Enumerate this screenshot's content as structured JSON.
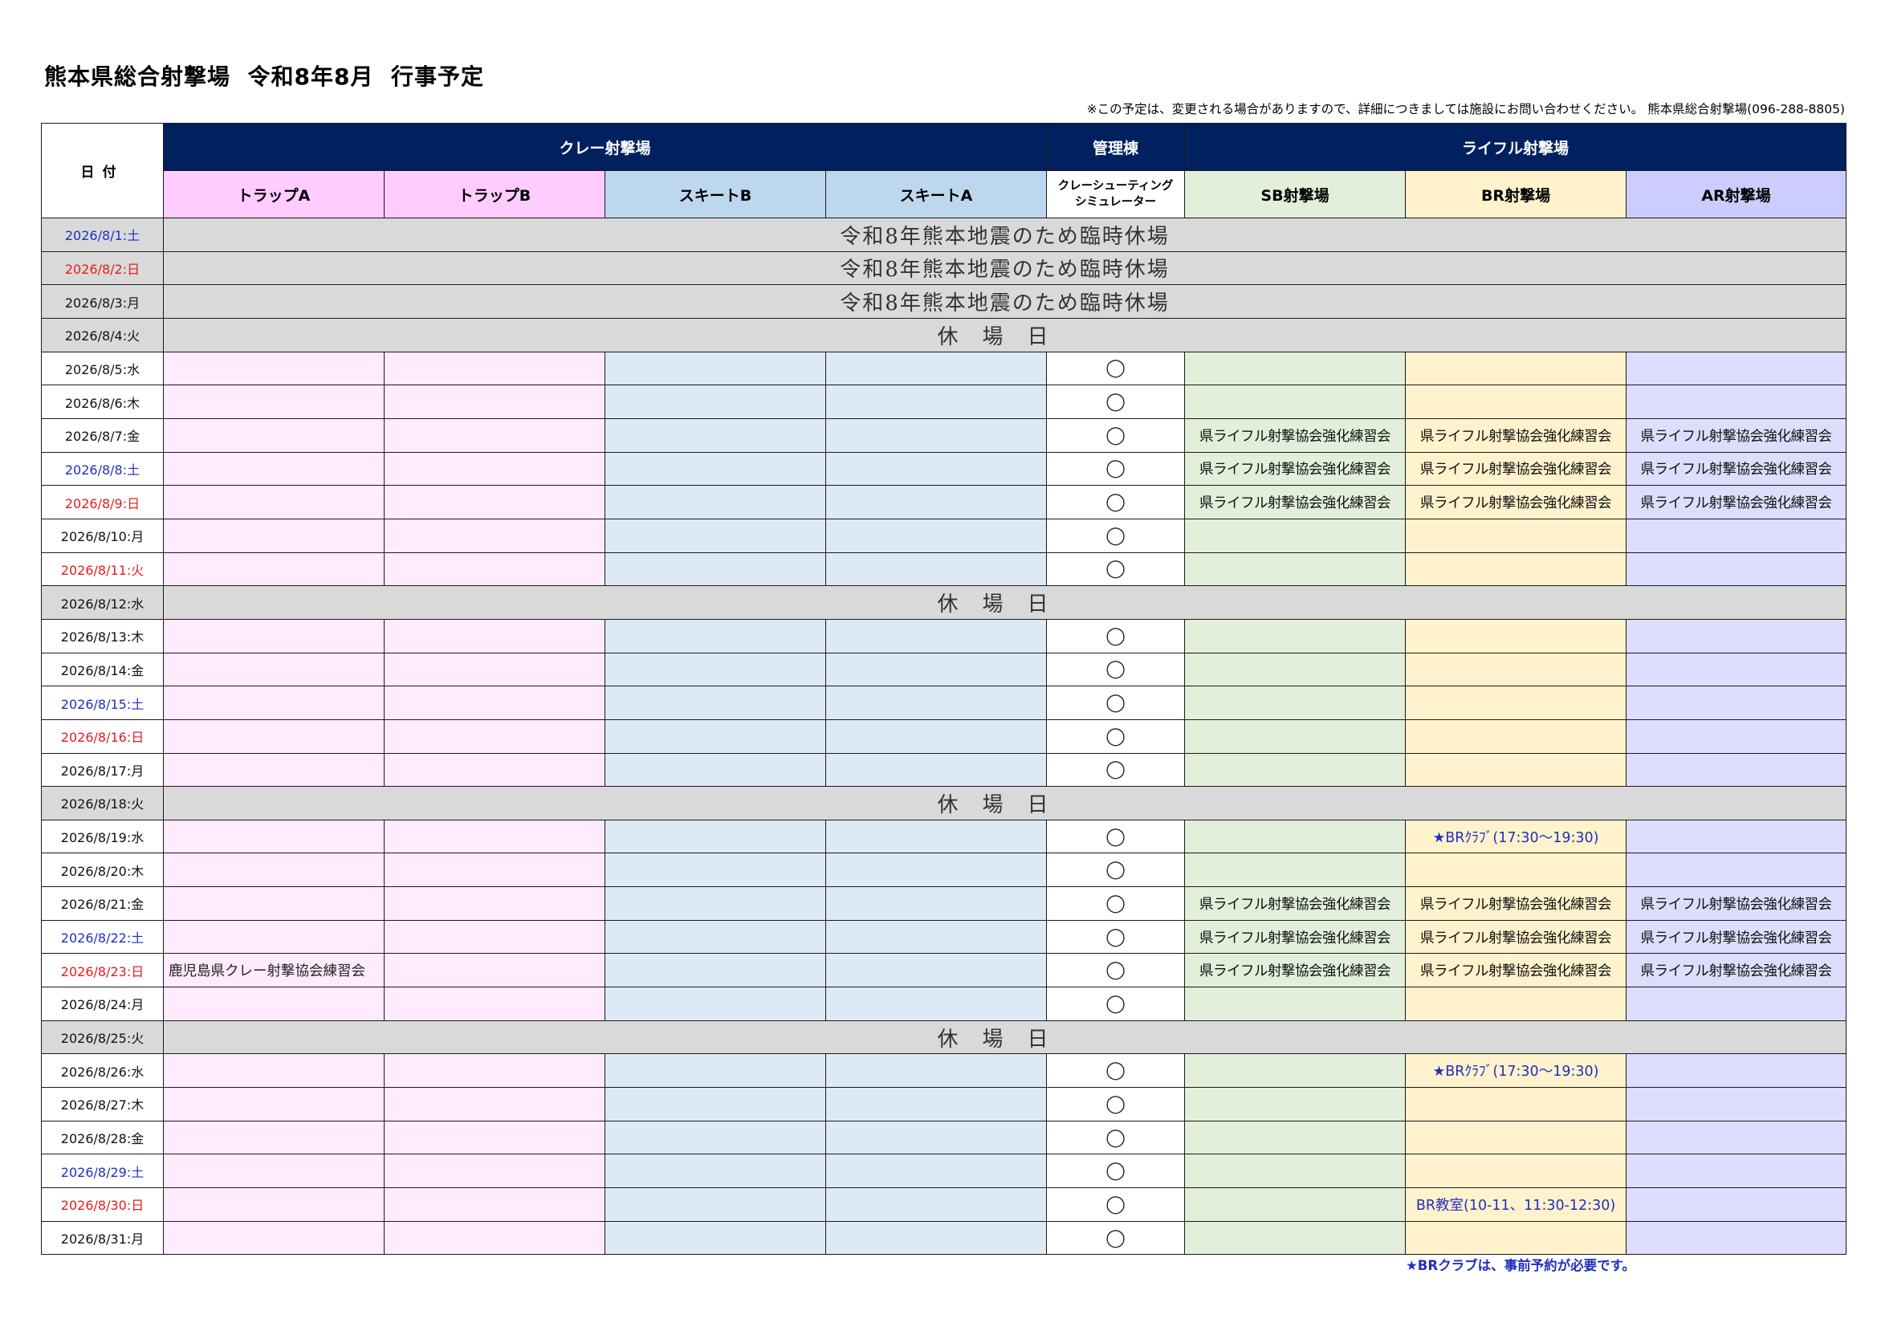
{
  "title": "熊本県総合射撃場  令和8年8月  行事予定",
  "notice": "※この予定は、変更される場合がありますので、詳細につきましては施設にお問い合わせください。 熊本県総合射撃場(096-288-8805)",
  "header": {
    "date_label": "日付",
    "group_clay": "クレー射撃場",
    "group_admin": "管理棟",
    "group_rifle": "ライフル射撃場",
    "trap_a": "トラップA",
    "trap_b": "トラップB",
    "skeet_b": "スキートB",
    "skeet_a": "スキートA",
    "simulator_line1": "クレーシューティング",
    "simulator_line2": "シミュレーター",
    "sb": "SB射撃場",
    "br": "BR射撃場",
    "ar": "AR射撃場"
  },
  "text": {
    "closed_earthquake": "令和8年熊本地震のため臨時休場",
    "closed_day": "休場日",
    "open_mark": "◯",
    "rifle_practice": "県ライフル射撃協会強化練習会",
    "br_club": "★BRｸﾗﾌﾞ(17:30～19:30)",
    "br_class": "BR教室(10-11、11:30-12:30)",
    "kagoshima_practice": "鹿児島県クレー射撃協会練習会"
  },
  "colors": {
    "header_navy": "#002060",
    "trap": "#ffccff",
    "skeet": "#bdd7ee",
    "sb": "#e2efda",
    "br": "#fff2cc",
    "ar": "#ccccff",
    "closed": "#d9d9d9",
    "saturday": "#1f2fbf",
    "holiday": "#e51c1c"
  },
  "rows": [
    {
      "date": "2026/8/1:土",
      "color": "blue",
      "status": "closed_earthquake"
    },
    {
      "date": "2026/8/2:日",
      "color": "red",
      "status": "closed_earthquake"
    },
    {
      "date": "2026/8/3:月",
      "color": "black",
      "status": "closed_earthquake"
    },
    {
      "date": "2026/8/4:火",
      "color": "black",
      "status": "closed_day"
    },
    {
      "date": "2026/8/5:水",
      "color": "black",
      "status": "open"
    },
    {
      "date": "2026/8/6:木",
      "color": "black",
      "status": "open"
    },
    {
      "date": "2026/8/7:金",
      "color": "black",
      "status": "open",
      "sb": "rifle_practice",
      "br": "rifle_practice",
      "ar": "rifle_practice"
    },
    {
      "date": "2026/8/8:土",
      "color": "blue",
      "status": "open",
      "sb": "rifle_practice",
      "br": "rifle_practice",
      "ar": "rifle_practice"
    },
    {
      "date": "2026/8/9:日",
      "color": "red",
      "status": "open",
      "sb": "rifle_practice",
      "br": "rifle_practice",
      "ar": "rifle_practice"
    },
    {
      "date": "2026/8/10:月",
      "color": "black",
      "status": "open"
    },
    {
      "date": "2026/8/11:火",
      "color": "red",
      "status": "open"
    },
    {
      "date": "2026/8/12:水",
      "color": "black",
      "status": "closed_day"
    },
    {
      "date": "2026/8/13:木",
      "color": "black",
      "status": "open"
    },
    {
      "date": "2026/8/14:金",
      "color": "black",
      "status": "open"
    },
    {
      "date": "2026/8/15:土",
      "color": "blue",
      "status": "open"
    },
    {
      "date": "2026/8/16:日",
      "color": "red",
      "status": "open"
    },
    {
      "date": "2026/8/17:月",
      "color": "black",
      "status": "open"
    },
    {
      "date": "2026/8/18:火",
      "color": "black",
      "status": "closed_day"
    },
    {
      "date": "2026/8/19:水",
      "color": "black",
      "status": "open",
      "br": "br_club"
    },
    {
      "date": "2026/8/20:木",
      "color": "black",
      "status": "open"
    },
    {
      "date": "2026/8/21:金",
      "color": "black",
      "status": "open",
      "sb": "rifle_practice",
      "br": "rifle_practice",
      "ar": "rifle_practice"
    },
    {
      "date": "2026/8/22:土",
      "color": "blue",
      "status": "open",
      "sb": "rifle_practice",
      "br": "rifle_practice",
      "ar": "rifle_practice"
    },
    {
      "date": "2026/8/23:日",
      "color": "red",
      "status": "open",
      "trap_a": "kagoshima_practice",
      "sb": "rifle_practice",
      "br": "rifle_practice",
      "ar": "rifle_practice"
    },
    {
      "date": "2026/8/24:月",
      "color": "black",
      "status": "open"
    },
    {
      "date": "2026/8/25:火",
      "color": "black",
      "status": "closed_day"
    },
    {
      "date": "2026/8/26:水",
      "color": "black",
      "status": "open",
      "br": "br_club"
    },
    {
      "date": "2026/8/27:木",
      "color": "black",
      "status": "open"
    },
    {
      "date": "2026/8/28:金",
      "color": "black",
      "status": "open"
    },
    {
      "date": "2026/8/29:土",
      "color": "blue",
      "status": "open"
    },
    {
      "date": "2026/8/30:日",
      "color": "red",
      "status": "open",
      "br": "br_class"
    },
    {
      "date": "2026/8/31:月",
      "color": "black",
      "status": "open"
    }
  ],
  "footnote": "★BRクラブは、事前予約が必要です。"
}
